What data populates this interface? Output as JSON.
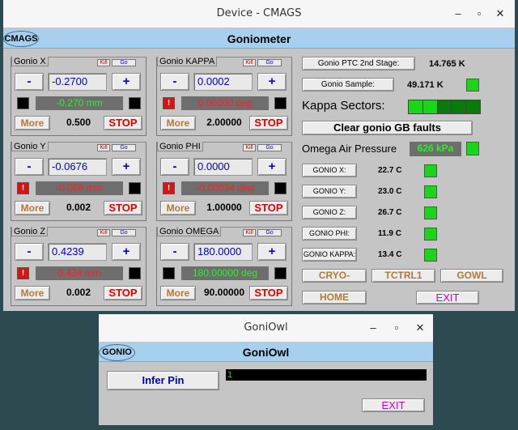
{
  "window1": {
    "title": "Device - CMAGS",
    "logo": "CMAGS",
    "header": "Goniometer",
    "axes": [
      {
        "label": "Gonio X",
        "kill": "Kill",
        "go": "Go",
        "minus": "-",
        "plus": "+",
        "setpoint": "-0.2700",
        "readback": "-0.270 mm",
        "readback_color": "green",
        "left_status": "black",
        "left_status_glyph": "",
        "right_status": "black",
        "more": "More",
        "step": "0.500",
        "stop": "STOP"
      },
      {
        "label": "Gonio KAPPA",
        "kill": "Kill",
        "go": "Go",
        "minus": "-",
        "plus": "+",
        "setpoint": "0.0002",
        "readback": "0.00000 deg",
        "readback_color": "red",
        "left_status": "red",
        "left_status_glyph": "!",
        "right_status": "black",
        "more": "More",
        "step": "2.00000",
        "stop": "STOP"
      },
      {
        "label": "Gonio Y",
        "kill": "Kill",
        "go": "Go",
        "minus": "-",
        "plus": "+",
        "setpoint": "-0.0676",
        "readback": "-0.068 mm",
        "readback_color": "red",
        "left_status": "red",
        "left_status_glyph": "!",
        "right_status": "black",
        "more": "More",
        "step": "0.002",
        "stop": "STOP"
      },
      {
        "label": "Gonio PHI",
        "kill": "Kill",
        "go": "Go",
        "minus": "-",
        "plus": "+",
        "setpoint": "0.0000",
        "readback": "-0.00034 deg",
        "readback_color": "red",
        "left_status": "red",
        "left_status_glyph": "!",
        "right_status": "black",
        "more": "More",
        "step": "1.00000",
        "stop": "STOP"
      },
      {
        "label": "Gonio Z",
        "kill": "Kill",
        "go": "Go",
        "minus": "-",
        "plus": "+",
        "setpoint": "0.4239",
        "readback": "0.424 mm",
        "readback_color": "red",
        "left_status": "red",
        "left_status_glyph": "!",
        "right_status": "black",
        "more": "More",
        "step": "0.002",
        "stop": "STOP"
      },
      {
        "label": "Gonio OMEGA",
        "kill": "Kill",
        "go": "Go",
        "minus": "-",
        "plus": "+",
        "setpoint": "180.0000",
        "readback": "180.00000 deg",
        "readback_color": "green",
        "left_status": "black",
        "left_status_glyph": "",
        "right_status": "black",
        "more": "More",
        "step": "90.00000",
        "stop": "STOP"
      }
    ],
    "ptc_button": "Gonio PTC 2nd Stage:",
    "ptc_value": "14.765 K",
    "sample_button": "Gonio Sample:",
    "sample_value": "49.171 K",
    "kappa_sectors_label": "Kappa Sectors:",
    "clear_faults": "Clear gonio GB faults",
    "omega_air_label": "Omega Air Pressure",
    "omega_air_value": "626 kPa",
    "temps": [
      {
        "button": "GONIO X:",
        "value": "22.7 C"
      },
      {
        "button": "GONIO Y:",
        "value": "23.0 C"
      },
      {
        "button": "GONIO Z:",
        "value": "26.7 C"
      },
      {
        "button": "GONIO PHI:",
        "value": "11.9 C"
      },
      {
        "button": "GONIO KAPPA:",
        "value": "13.4 C"
      }
    ],
    "nav": {
      "cryo": "CRYO-TEMPS",
      "tctrl": "TCTRL1",
      "gowl": "GOWL",
      "home": "HOME",
      "exit": "EXIT"
    },
    "colors": {
      "ok": "#19d619",
      "fault": "#e01010",
      "accent": "#a7d0ee"
    }
  },
  "window2": {
    "title": "GoniOwl",
    "logo": "GONIO",
    "header": "GoniOwl",
    "infer_pin": "Infer Pin",
    "output": "1",
    "exit": "EXIT"
  }
}
